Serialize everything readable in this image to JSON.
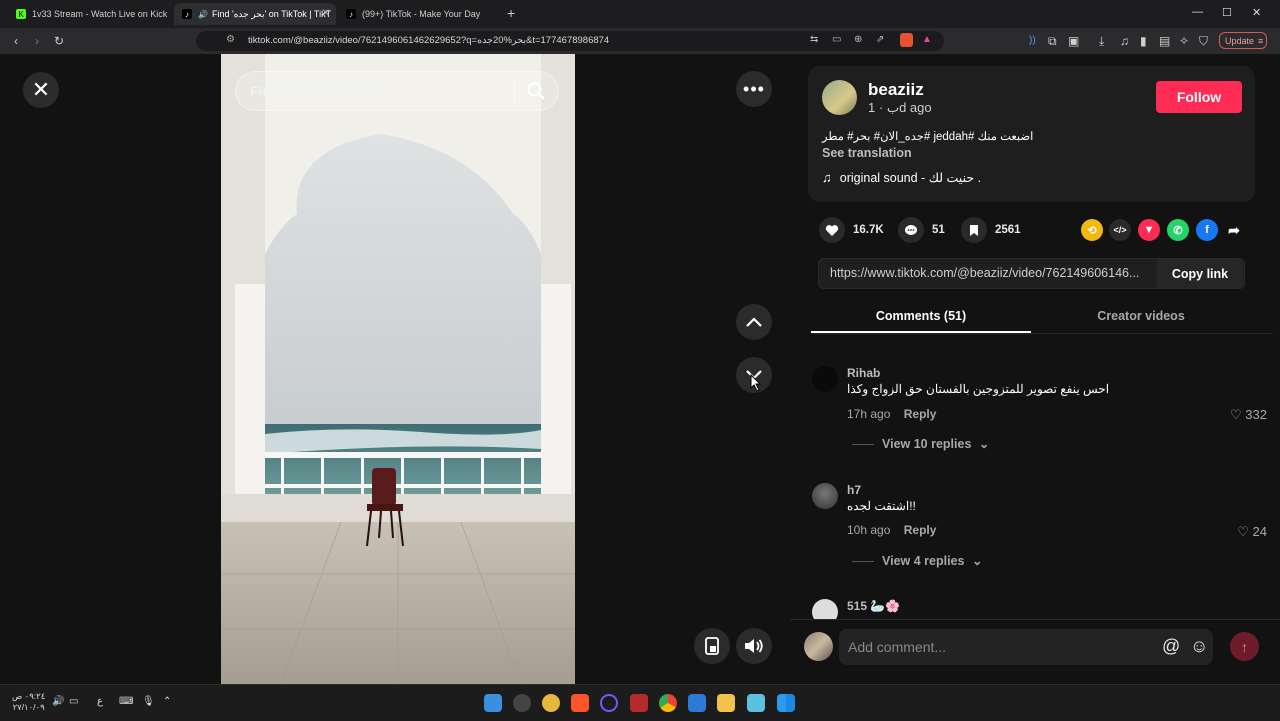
{
  "browser": {
    "tabs": [
      {
        "label": "1v33 Stream - Watch Live on Kick",
        "active": false
      },
      {
        "label": "Find 'بحر جده' on TikTok | TikT",
        "active": true
      },
      {
        "label": "(99+) TikTok - Make Your Day",
        "active": false
      }
    ],
    "new_tab": "+",
    "url": "tiktok.com/@beaziiz/video/7621496061462629652?q=بحر%20جده&t=1774678986874",
    "update_label": "Update"
  },
  "video": {
    "search_placeholder": "Find related content"
  },
  "author": {
    "username": "beaziiz",
    "nickname": "ب",
    "time": "1d ago",
    "follow_label": "Follow",
    "description": "جده_الان# بحر# مطر# jeddah# اضبعت منك",
    "see_translation": "See translation",
    "sound": "original sound - حنيت لك ."
  },
  "stats": {
    "likes": "16.7K",
    "comments": "51",
    "saves": "2561"
  },
  "share": {
    "link": "https://www.tiktok.com/@beaziiz/video/762149606146...",
    "copy_label": "Copy link"
  },
  "panel_tabs": [
    {
      "label": "Comments (51)",
      "active": true
    },
    {
      "label": "Creator videos",
      "active": false
    }
  ],
  "comments": [
    {
      "name": "Rihab",
      "text": "احس ينفع تصوير للمتزوجين بالفستان حق الزواج وكذا",
      "time": "17h ago",
      "reply": "Reply",
      "likes": "332",
      "view_replies": "View 10 replies"
    },
    {
      "name": "h7",
      "text": "اشتقت لجده!!",
      "time": "10h ago",
      "reply": "Reply",
      "likes": "24",
      "view_replies": "View 4 replies"
    },
    {
      "name": "515 🦢🌸"
    }
  ],
  "comment_input": {
    "placeholder": "Add comment..."
  },
  "taskbar": {
    "time": "٠٩:٢٤ ص",
    "date": "٢٧/١٠/٠٩",
    "lang": "ع"
  },
  "colors": {
    "accent": "#fe2c55",
    "background": "#121212",
    "card": "#1e1e1e"
  }
}
